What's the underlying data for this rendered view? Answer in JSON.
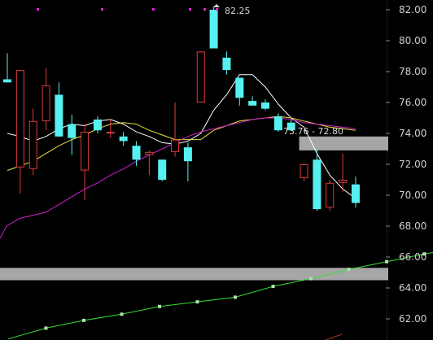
{
  "chart_data": {
    "type": "candlestick",
    "y_axis": {
      "ylim": [
        60.6,
        82.7
      ],
      "ticks": [
        "82.00",
        "80.00",
        "78.00",
        "76.00",
        "74.00",
        "72.00",
        "70.00",
        "68.00",
        "66.00",
        "64.00",
        "62.00"
      ],
      "position": "right"
    },
    "grid": false,
    "colors": {
      "background": "#000000",
      "up": "#dd3b3b",
      "down": "#56f0f0",
      "ma_white": "#ffffff",
      "ma_yellow": "#e8e23a",
      "ma_magenta": "#d020d0",
      "ma_green": "#33dd33",
      "marker": "#b0e0b0",
      "band": "#a6a6a6",
      "dots": "#e61ee6"
    },
    "candles": [
      {
        "open": 77.5,
        "high": 79.2,
        "low": 77.3,
        "close": 77.3
      },
      {
        "open": 71.8,
        "high": 78.1,
        "low": 70.1,
        "close": 78.1
      },
      {
        "open": 71.7,
        "high": 75.6,
        "low": 71.3,
        "close": 74.8
      },
      {
        "open": 74.8,
        "high": 78.2,
        "low": 74.2,
        "close": 77.1
      },
      {
        "open": 76.5,
        "high": 77.3,
        "low": 73.8,
        "close": 73.8
      },
      {
        "open": 74.6,
        "high": 75.2,
        "low": 72.6,
        "close": 73.7
      },
      {
        "open": 71.6,
        "high": 74.6,
        "low": 69.7,
        "close": 74.1
      },
      {
        "open": 74.9,
        "high": 75.1,
        "low": 74.0,
        "close": 74.2
      },
      {
        "open": 74.1,
        "high": 74.9,
        "low": 73.7,
        "close": 74.1
      },
      {
        "open": 73.8,
        "high": 74.1,
        "low": 73.2,
        "close": 73.5
      },
      {
        "open": 73.2,
        "high": 73.5,
        "low": 71.9,
        "close": 72.3
      },
      {
        "open": 72.6,
        "high": 72.9,
        "low": 71.3,
        "close": 72.8
      },
      {
        "open": 72.3,
        "high": 72.3,
        "low": 70.9,
        "close": 71.0
      },
      {
        "open": 72.8,
        "high": 76.0,
        "low": 72.5,
        "close": 73.6
      },
      {
        "open": 73.1,
        "high": 73.4,
        "low": 70.9,
        "close": 72.2
      },
      {
        "open": 76.0,
        "high": 79.3,
        "low": 76.0,
        "close": 79.3
      },
      {
        "open": 82.0,
        "high": 82.2,
        "low": 79.5,
        "close": 79.5
      },
      {
        "open": 78.9,
        "high": 79.3,
        "low": 77.8,
        "close": 78.1
      },
      {
        "open": 77.6,
        "high": 77.6,
        "low": 75.8,
        "close": 76.3
      },
      {
        "open": 76.1,
        "high": 76.4,
        "low": 75.8,
        "close": 75.8
      },
      {
        "open": 76.0,
        "high": 76.2,
        "low": 75.5,
        "close": 75.6
      },
      {
        "open": 75.1,
        "high": 75.3,
        "low": 74.1,
        "close": 74.2
      },
      {
        "open": 74.7,
        "high": 74.9,
        "low": 74.2,
        "close": 74.2
      },
      {
        "open": 71.1,
        "high": 72.0,
        "low": 70.9,
        "close": 72.0
      },
      {
        "open": 72.3,
        "high": 73.0,
        "low": 69.0,
        "close": 69.1
      },
      {
        "open": 69.2,
        "high": 71.0,
        "low": 69.0,
        "close": 70.8
      },
      {
        "open": 70.8,
        "high": 72.7,
        "low": 70.2,
        "close": 71.0
      },
      {
        "open": 70.7,
        "high": 71.2,
        "low": 69.2,
        "close": 69.5
      }
    ],
    "ma_lines": [
      {
        "color": "ma_white",
        "values": [
          74.0,
          73.8,
          73.5,
          73.8,
          74.3,
          74.6,
          74.5,
          74.8,
          74.9,
          74.6,
          74.1,
          73.8,
          73.4,
          73.3,
          73.5,
          74.0,
          75.5,
          76.5,
          77.8,
          77.8,
          77.0,
          75.9,
          75.0,
          74.4,
          72.7,
          71.3,
          70.4,
          69.8
        ]
      },
      {
        "color": "ma_yellow",
        "values": [
          71.6,
          71.9,
          72.2,
          72.7,
          73.2,
          73.6,
          73.9,
          74.3,
          74.6,
          74.7,
          74.6,
          74.2,
          73.9,
          73.6,
          73.6,
          73.6,
          74.2,
          74.5,
          74.8,
          74.9,
          75.0,
          75.1,
          75.0,
          74.8,
          74.6,
          74.4,
          74.3,
          74.2
        ]
      },
      {
        "color": "ma_magenta",
        "values": [
          null,
          null,
          null,
          68.9,
          69.4,
          69.9,
          70.4,
          70.8,
          71.3,
          71.7,
          72.2,
          72.6,
          73.0,
          73.4,
          73.8,
          74.1,
          74.3,
          74.5,
          74.7,
          74.9,
          75.0,
          75.0,
          74.9,
          74.7,
          74.6,
          74.5,
          74.4,
          74.3
        ]
      }
    ],
    "ma_line_green": {
      "points": [
        [
          0,
          60.7
        ],
        [
          1,
          61.4
        ],
        [
          2,
          61.9
        ],
        [
          3,
          62.3
        ],
        [
          4,
          62.8
        ],
        [
          5,
          63.1
        ],
        [
          6,
          63.4
        ],
        [
          7,
          64.1
        ],
        [
          8,
          64.6
        ],
        [
          9,
          65.2
        ],
        [
          10,
          65.7
        ],
        [
          11,
          66.2
        ],
        [
          12,
          66.6
        ]
      ],
      "marked": [
        1,
        2,
        3,
        4,
        5,
        6,
        7,
        8,
        9,
        10,
        11
      ]
    },
    "bands": [
      {
        "from": 72.9,
        "to": 73.8,
        "x_start_candle": 23
      },
      {
        "from": 64.5,
        "to": 65.3,
        "x_start_candle": 0
      }
    ],
    "dots_row": {
      "y": 82.7,
      "count": 6
    },
    "annotations": [
      {
        "text": "82.25"
      },
      {
        "text": "73.76 - 72.80"
      }
    ]
  }
}
